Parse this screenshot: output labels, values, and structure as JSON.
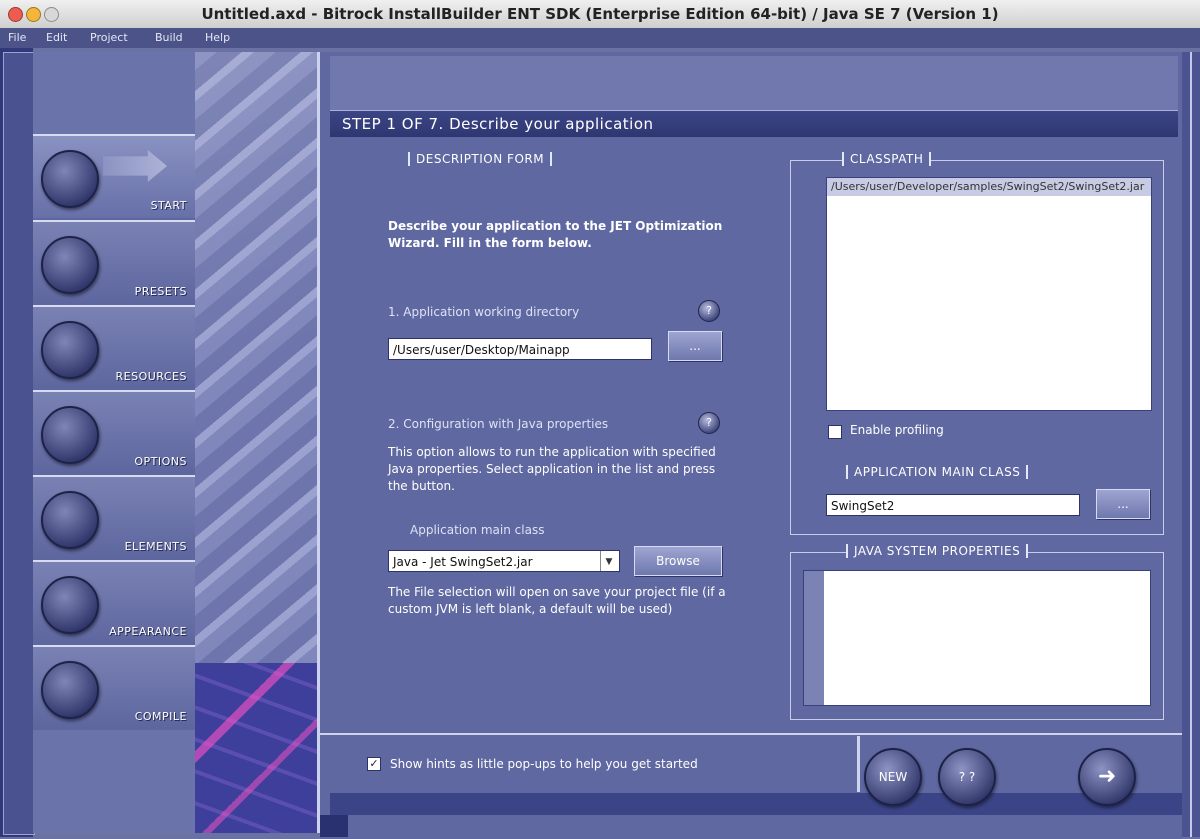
{
  "window": {
    "title": "Untitled.axd - Bitrock InstallBuilder ENT SDK (Enterprise Edition 64-bit) / Java SE 7 (Version 1)"
  },
  "menu": [
    "File",
    "Edit",
    "Project",
    "Build",
    "Help"
  ],
  "sidebar": {
    "items": [
      {
        "label": "START",
        "active": true
      },
      {
        "label": "PRESETS"
      },
      {
        "label": "RESOURCES"
      },
      {
        "label": "OPTIONS"
      },
      {
        "label": "ELEMENTS"
      },
      {
        "label": "APPEARANCE"
      },
      {
        "label": "COMPILE"
      }
    ]
  },
  "step": {
    "title": "STEP 1 OF 7. Describe your application"
  },
  "description_form": {
    "legend": "DESCRIPTION FORM",
    "intro": "Describe your application to the JET Optimization Wizard. Fill in the form below.",
    "field1_label": "1. Application working directory",
    "field1_value": "/Users/user/Desktop/Mainapp",
    "browse_label": "...",
    "field2_label": "2. Configuration with Java properties",
    "field2_desc": "This option allows to run the application with specified Java properties. Select application in the list and press the button.",
    "main_class_label": "Application main class",
    "main_class_value": "Java - Jet SwingSet2.jar",
    "browse2_label": "Browse",
    "note": "The File selection will open on save your project file (if a custom JVM is left blank, a default will be used)"
  },
  "classpath": {
    "legend": "CLASSPATH",
    "entries": [
      "/Users/user/Developer/samples/SwingSet2/SwingSet2.jar"
    ],
    "checkbox_label": "Enable profiling"
  },
  "main_class": {
    "legend": "APPLICATION MAIN CLASS",
    "value": "SwingSet2",
    "button_label": "..."
  },
  "system_properties": {
    "legend": "JAVA SYSTEM PROPERTIES"
  },
  "bottom": {
    "checkbox_label": "Show hints as little pop-ups to help you get started",
    "checkbox_checked": true,
    "buttons": {
      "new": "NEW",
      "help": "? ?",
      "next": "➜"
    }
  }
}
